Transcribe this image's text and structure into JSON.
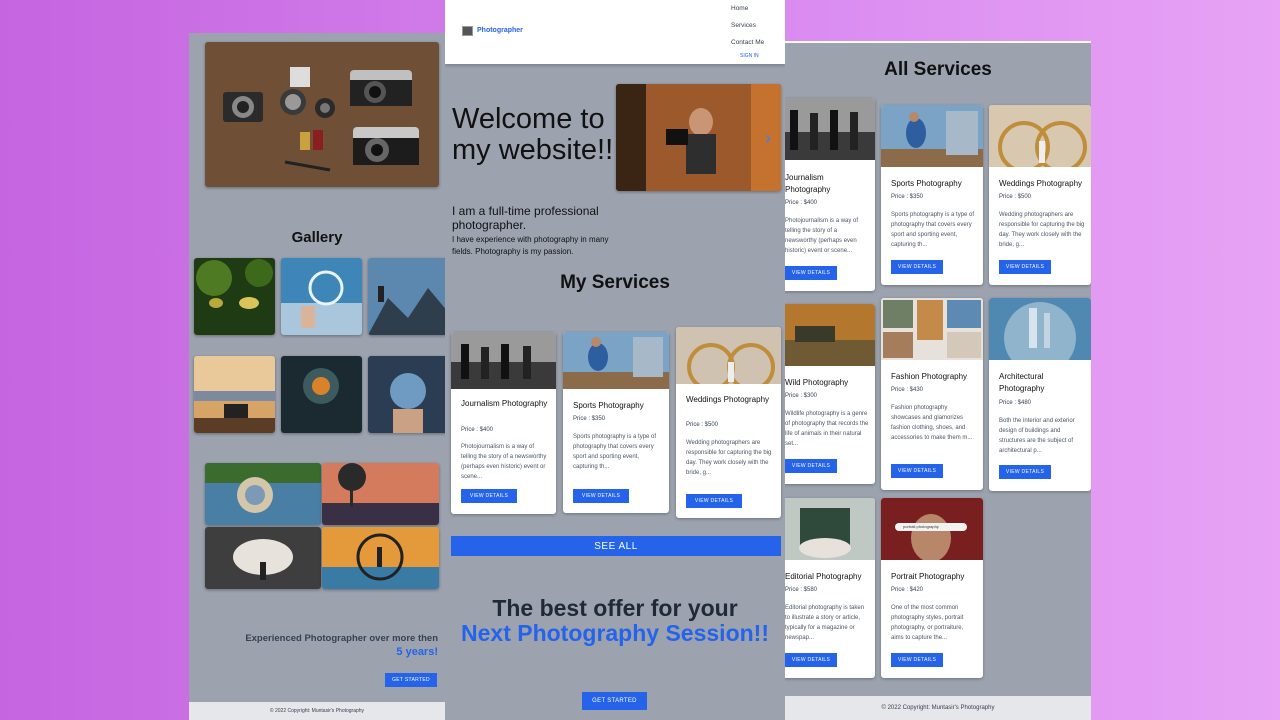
{
  "left": {
    "gallery_title": "Gallery",
    "experience_text": "Experienced Photographer over more then",
    "experience_highlight": "5 years!",
    "cta_label": "GET STARTED",
    "footer": "© 2022 Copyright: Muntasir's Photography"
  },
  "nav": {
    "brand": "Photographer",
    "items": [
      "Home",
      "Services",
      "Contact Me"
    ],
    "signin": "SIGN IN"
  },
  "hero": {
    "title": "Welcome to my website!!",
    "subtitle": "I am a full-time professional photographer.",
    "description": "I have experience with photography in many fields. Photography is my passion."
  },
  "my_services": {
    "title": "My Services",
    "cards": [
      {
        "title": "Journalism Photography",
        "price": "Price : $400",
        "description": "Photojournalism is a way of telling the story of a newsworthy (perhaps even historic) event or scene...",
        "button": "VIEW DETAILS"
      },
      {
        "title": "Sports Photography",
        "price": "Price : $350",
        "description": "Sports photography is a type of photography that covers every sport and sporting event, capturing th...",
        "button": "VIEW DETAILS"
      },
      {
        "title": "Weddings Photography",
        "price": "Price : $500",
        "description": "Wedding photographers are responsible for capturing the big day. They work closely with the bride, g...",
        "button": "VIEW DETAILS"
      }
    ],
    "see_all": "SEE ALL"
  },
  "offer": {
    "line1": "The best offer for your",
    "line2": "Next Photography Session!!",
    "cta": "GET STARTED"
  },
  "all_services": {
    "title": "All Services",
    "cards": [
      {
        "title": "Journalism Photography",
        "price": "Price : $400",
        "description": "Photojournalism is a way of telling the story of a newsworthy (perhaps even historic) event or scene...",
        "button": "VIEW DETAILS"
      },
      {
        "title": "Sports Photography",
        "price": "Price : $350",
        "description": "Sports photography is a type of photography that covers every sport and sporting event, capturing th...",
        "button": "VIEW DETAILS"
      },
      {
        "title": "Weddings Photography",
        "price": "Price : $500",
        "description": "Wedding photographers are responsible for capturing the big day. They work closely with the bride, g...",
        "button": "VIEW DETAILS"
      },
      {
        "title": "Wild Photography",
        "price": "Price : $300",
        "description": "Wildlife photography is a genre of photography that records the life of animals in their natural set...",
        "button": "VIEW DETAILS"
      },
      {
        "title": "Fashion Photography",
        "price": "Price : $430",
        "description": "Fashion photography showcases and glamorizes fashion clothing, shoes, and accessories to make them m...",
        "button": "VIEW DETAILS"
      },
      {
        "title": "Architectural Photography",
        "price": "Price : $480",
        "description": "Both the interior and exterior design of buildings and structures are the subject of architectural p...",
        "button": "VIEW DETAILS"
      },
      {
        "title": "Editorial Photography",
        "price": "Price : $580",
        "description": "Editorial photography is taken to illustrate a story or article, typically for a magazine or newspap...",
        "button": "VIEW DETAILS"
      },
      {
        "title": "Portrait Photography",
        "price": "Price : $420",
        "description": "One of the most common photography styles, portrait photography, or portraiture, aims to capture the...",
        "button": "VIEW DETAILS"
      }
    ],
    "portrait_search_text": "portrait photography",
    "footer_prefix": "© 2022 Copyright:",
    "footer_name": "Muntasir's Photography"
  },
  "colors": {
    "accent": "#2563eb",
    "panel_bg": "#9ca3af",
    "page_bg": "#d07be8"
  }
}
